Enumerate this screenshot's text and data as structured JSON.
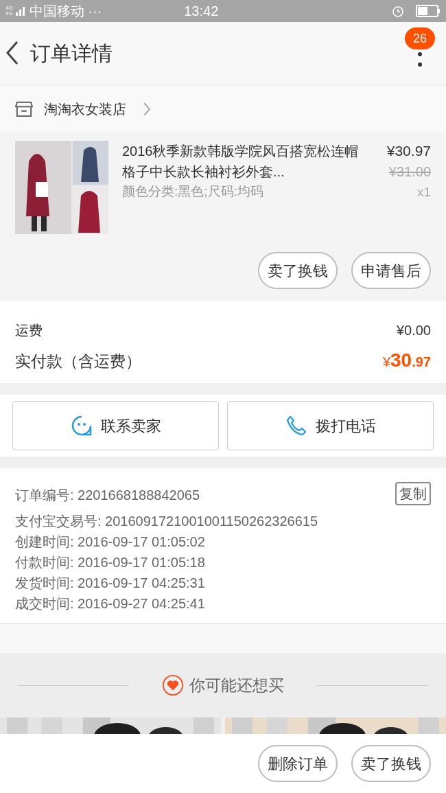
{
  "status_bar": {
    "network_labels": [
      "4G",
      "4G"
    ],
    "carrier": "中国移动 ···",
    "time": "13:42"
  },
  "header": {
    "title": "订单详情",
    "badge": "26"
  },
  "store": {
    "name": "淘淘衣女装店"
  },
  "product": {
    "title": "2016秋季新款韩版学院风百搭宽松连帽格子中长款长袖衬衫外套...",
    "variant": "颜色分类:黑色;尺码:均码",
    "price": "¥30.97",
    "original_price": "¥31.00",
    "quantity": "x1",
    "buttons": [
      "卖了换钱",
      "申请售后"
    ]
  },
  "fees": {
    "shipping_label": "运费",
    "shipping_value": "¥0.00",
    "total_label": "实付款（含运费）",
    "total_currency": "¥",
    "total_integer": "30",
    "total_decimal": ".97"
  },
  "contact_buttons": [
    {
      "kind": "chat",
      "label": "联系卖家"
    },
    {
      "kind": "phone",
      "label": "拨打电话"
    }
  ],
  "order_info": {
    "copy_button": "复制",
    "lines": [
      "订单编号: 2201668188842065",
      "支付宝交易号: 2016091721001001150262326615",
      "创建时间: 2016-09-17 01:05:02",
      "付款时间: 2016-09-17 01:05:18",
      "发货时间: 2016-09-17 04:25:31",
      "成交时间: 2016-09-27 04:25:41"
    ]
  },
  "recommendations": {
    "title": "你可能还想买"
  },
  "bottom_bar": {
    "buttons": [
      "删除订单",
      "卖了换钱"
    ]
  }
}
